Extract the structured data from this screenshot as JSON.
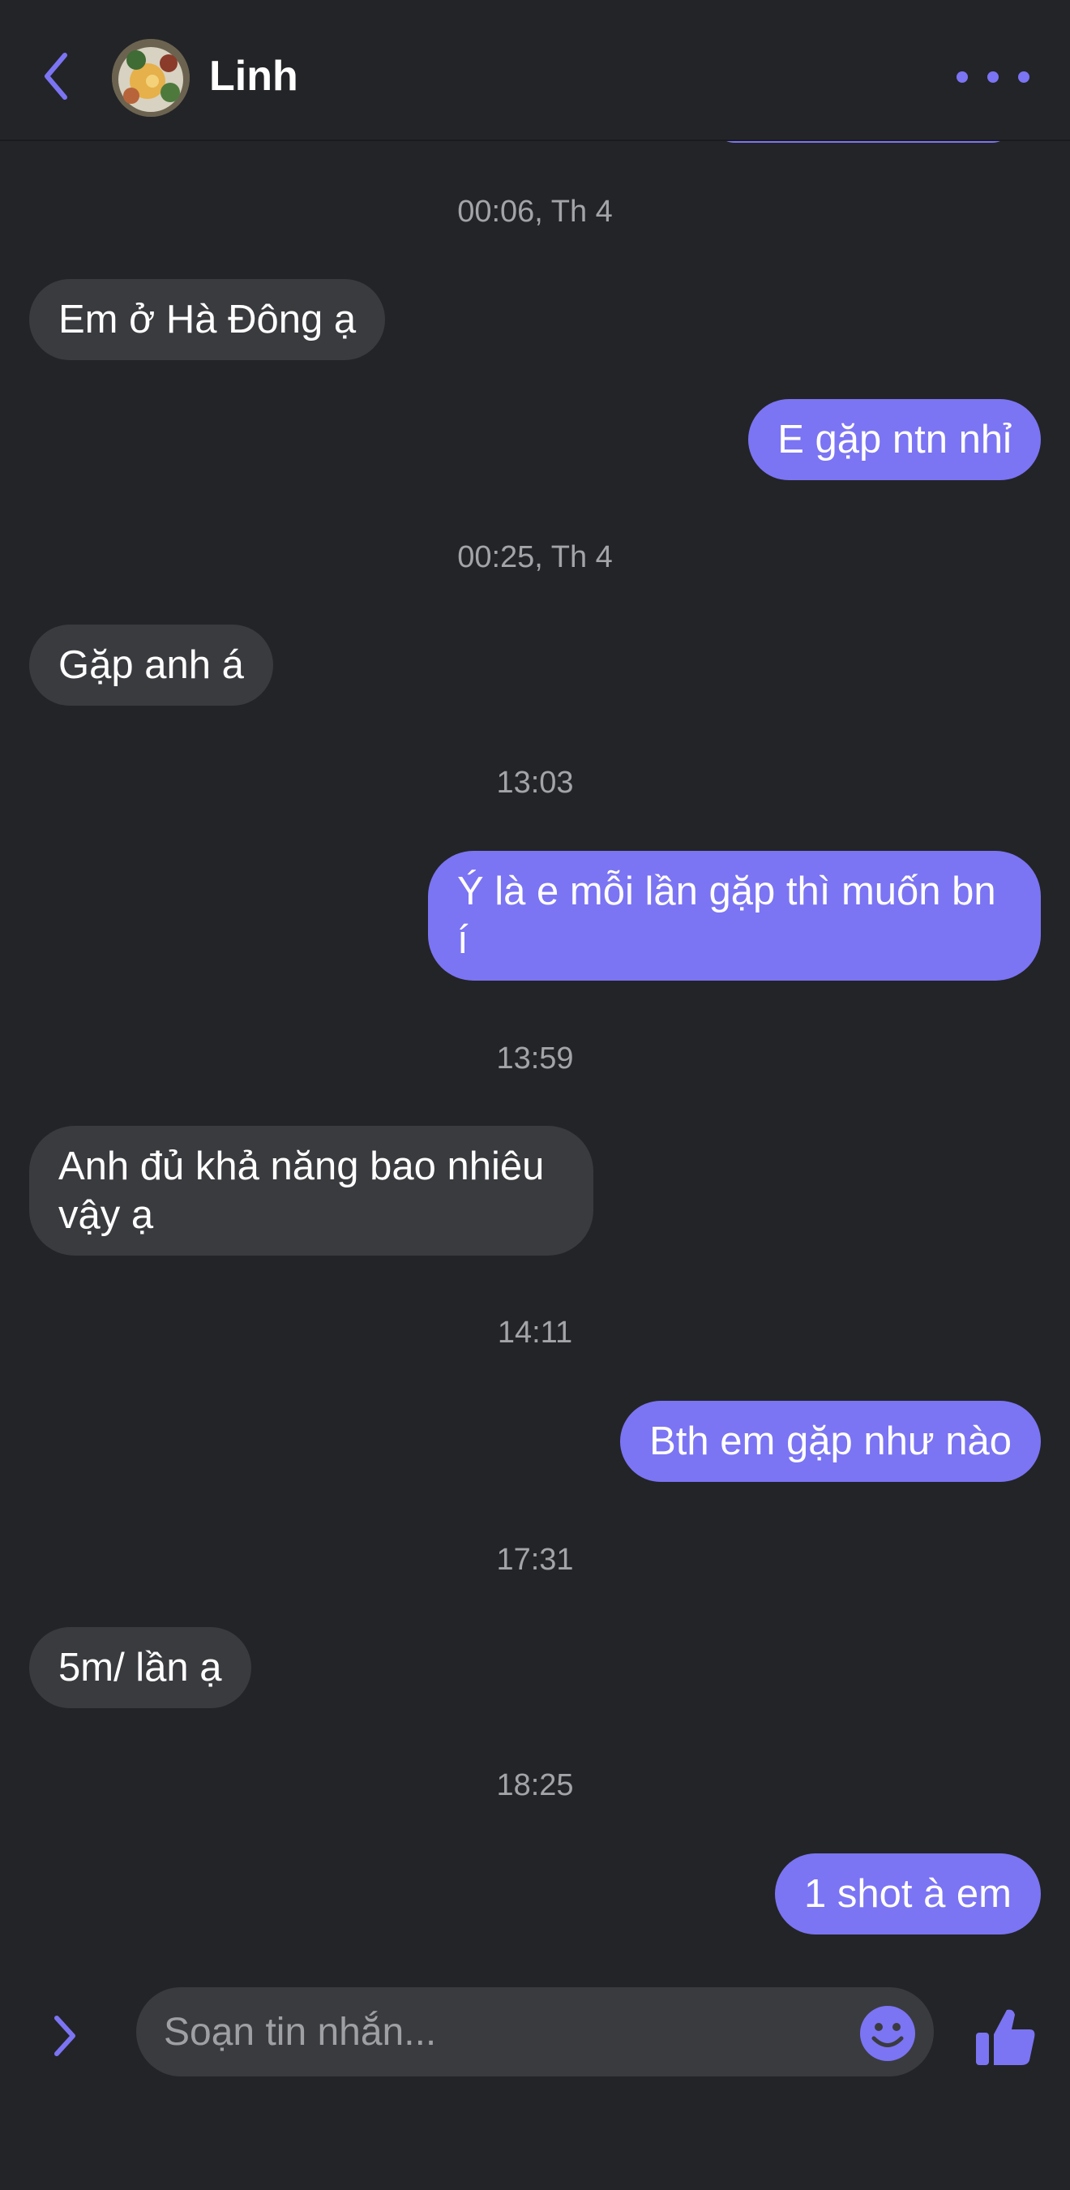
{
  "header": {
    "contact_name": "Linh"
  },
  "messages": [
    {
      "type": "timestamp",
      "text": "00:06, Th 4"
    },
    {
      "type": "incoming",
      "text": "Em ở Hà Đông ạ"
    },
    {
      "type": "outgoing",
      "text": "E gặp ntn nhỉ"
    },
    {
      "type": "timestamp",
      "text": "00:25, Th 4"
    },
    {
      "type": "incoming",
      "text": "Gặp anh á"
    },
    {
      "type": "timestamp",
      "text": "13:03"
    },
    {
      "type": "outgoing",
      "text": "Ý là e mỗi lần gặp thì muốn bn í"
    },
    {
      "type": "timestamp",
      "text": "13:59"
    },
    {
      "type": "incoming",
      "text": "Anh đủ khả năng bao nhiêu vậy ạ"
    },
    {
      "type": "timestamp",
      "text": "14:11"
    },
    {
      "type": "outgoing",
      "text": "Bth em gặp như nào"
    },
    {
      "type": "timestamp",
      "text": "17:31"
    },
    {
      "type": "incoming",
      "text": "5m/ lần ạ"
    },
    {
      "type": "timestamp",
      "text": "18:25"
    },
    {
      "type": "outgoing",
      "text": "1 shot à em"
    }
  ],
  "composer": {
    "placeholder": "Soạn tin nhắn..."
  },
  "icons": {
    "back": "chevron-left-icon",
    "more": "more-dots-icon",
    "expand": "chevron-right-icon",
    "emoji": "smiley-icon",
    "like": "thumbs-up-icon"
  },
  "colors": {
    "accent": "#7b74f3",
    "background": "#232427",
    "incoming_bubble": "#3a3b3f",
    "timestamp_text": "#a3a4a8"
  }
}
